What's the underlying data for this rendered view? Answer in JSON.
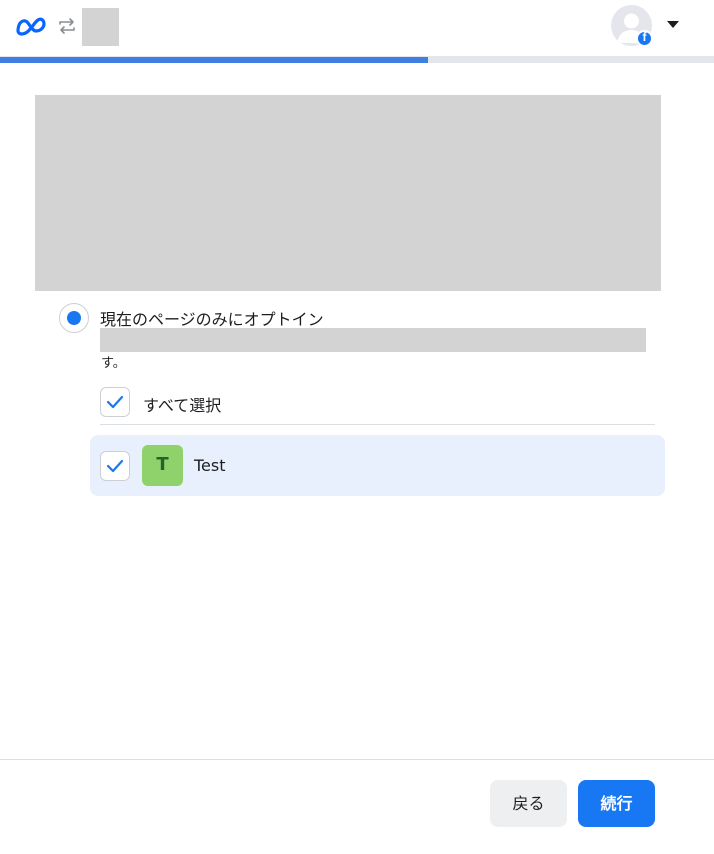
{
  "header": {
    "logo_icon": "meta-logo-icon",
    "switch_icon": "swap-arrows-icon",
    "avatar_icon": "user-avatar-icon",
    "badge_icon": "facebook-badge-icon",
    "badge_letter": "f",
    "dropdown_icon": "caret-down-icon"
  },
  "progress": {
    "value": 0.6,
    "fill_color": "#3f7ee2"
  },
  "option": {
    "selected": true,
    "label": "現在のページのみにオプトイン",
    "description_tail": "す。"
  },
  "select_all": {
    "checked": true,
    "label": "すべて選択"
  },
  "pages": [
    {
      "checked": true,
      "initial": "T",
      "name": "Test",
      "avatar_color": "#8fd16a"
    }
  ],
  "footer": {
    "back_label": "戻る",
    "continue_label": "続行",
    "primary_color": "#1877f2"
  }
}
